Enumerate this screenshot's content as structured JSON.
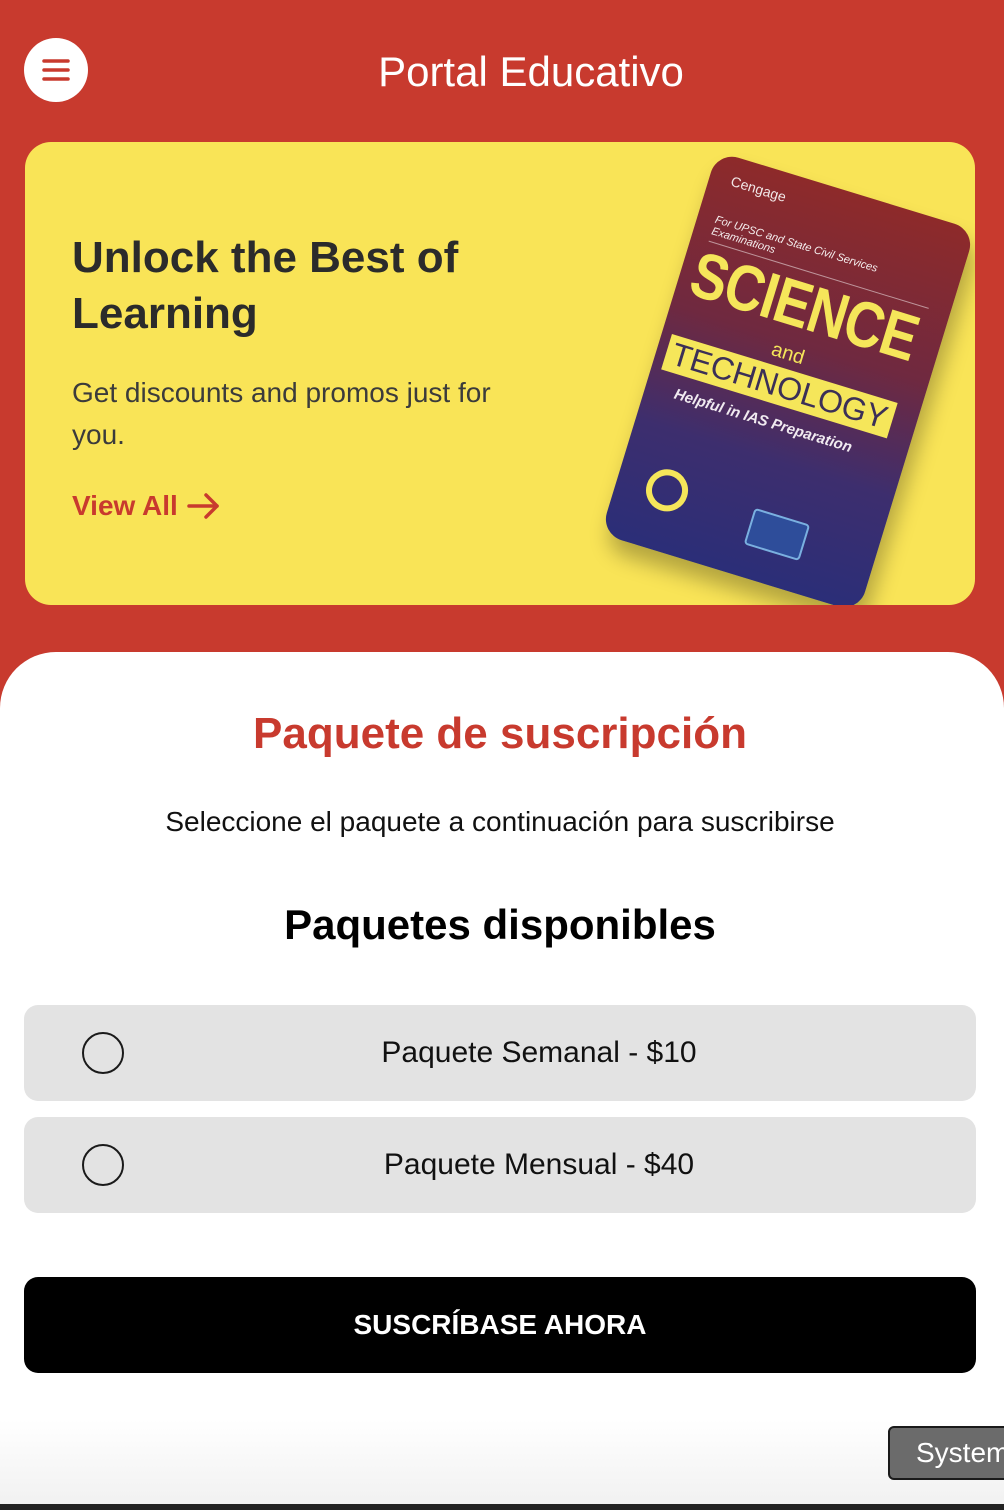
{
  "header": {
    "title": "Portal Educativo",
    "menu_icon": "hamburger-menu-icon"
  },
  "banner": {
    "title": "Unlock the Best of Learning",
    "subtitle": "Get discounts and promos just for you.",
    "link_label": "View All",
    "link_icon": "arrow-right-icon",
    "background_color": "#f9e457",
    "book": {
      "publisher": "Cengage",
      "topline": "For UPSC and State Civil Services Examinations",
      "title_line1": "SCIENCE",
      "title_and": "and",
      "title_line2": "TECHNOLOGY",
      "tagline": "Helpful in IAS Preparation"
    }
  },
  "subscription": {
    "title": "Paquete de suscripción",
    "subtitle": "Seleccione el paquete a continuación para suscribirse",
    "packages_heading": "Paquetes disponibles",
    "packages": [
      {
        "label": "Paquete Semanal - $10",
        "selected": false
      },
      {
        "label": "Paquete Mensual - $40",
        "selected": false
      }
    ],
    "subscribe_label": "SUSCRÍBASE AHORA"
  },
  "system_chip": {
    "label": "System"
  },
  "colors": {
    "brand_red": "#c83a2e",
    "banner_yellow": "#f9e457",
    "package_bg": "#e3e3e3",
    "button_black": "#000000"
  }
}
